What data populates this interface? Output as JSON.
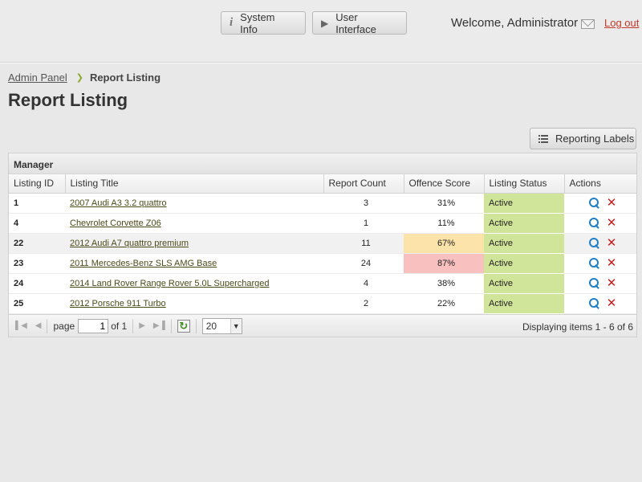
{
  "header": {
    "system_info_label": "System Info",
    "user_interface_label": "User Interface",
    "welcome_text": "Welcome, Administrator",
    "logout_label": "Log out"
  },
  "breadcrumb": {
    "parent": "Admin Panel",
    "current": "Report Listing"
  },
  "page_title": "Report Listing",
  "reporting_labels_button": "Reporting Labels",
  "panel": {
    "title": "Manager",
    "columns": [
      "Listing ID",
      "Listing Title",
      "Report Count",
      "Offence Score",
      "Listing Status",
      "Actions"
    ],
    "rows": [
      {
        "id": "1",
        "title": "2007 Audi A3 3.2 quattro",
        "count": "3",
        "score": "31%",
        "status": "Active"
      },
      {
        "id": "4",
        "title": "Chevrolet Corvette Z06",
        "count": "1",
        "score": "11%",
        "status": "Active"
      },
      {
        "id": "22",
        "title": "2012 Audi A7 quattro premium",
        "count": "11",
        "score": "67%",
        "status": "Active"
      },
      {
        "id": "23",
        "title": "2011 Mercedes-Benz SLS AMG Base",
        "count": "24",
        "score": "87%",
        "status": "Active"
      },
      {
        "id": "24",
        "title": "2014 Land Rover Range Rover 5.0L Supercharged",
        "count": "4",
        "score": "38%",
        "status": "Active"
      },
      {
        "id": "25",
        "title": "2012 Porsche 911 Turbo",
        "count": "2",
        "score": "22%",
        "status": "Active"
      }
    ]
  },
  "pager": {
    "page_label": "page",
    "page_value": "1",
    "of_label": "of 1",
    "page_size": "20",
    "displaying": "Displaying items 1 - 6 of 6"
  },
  "colors": {
    "status_active": "#d1e59a",
    "score_warning": "#fce3a9",
    "score_danger": "#f9c0c0",
    "logout": "#c0392b",
    "search_icon": "#1f7fc4",
    "delete_icon": "#c81d1d"
  },
  "icons": {
    "system_info": "info-icon",
    "user_interface": "play-arrow-icon",
    "welcome": "mail-icon",
    "breadcrumb_separator": "chevron-right-icon",
    "reporting_labels": "list-icon",
    "row_view": "search-icon",
    "row_delete": "delete-icon"
  }
}
